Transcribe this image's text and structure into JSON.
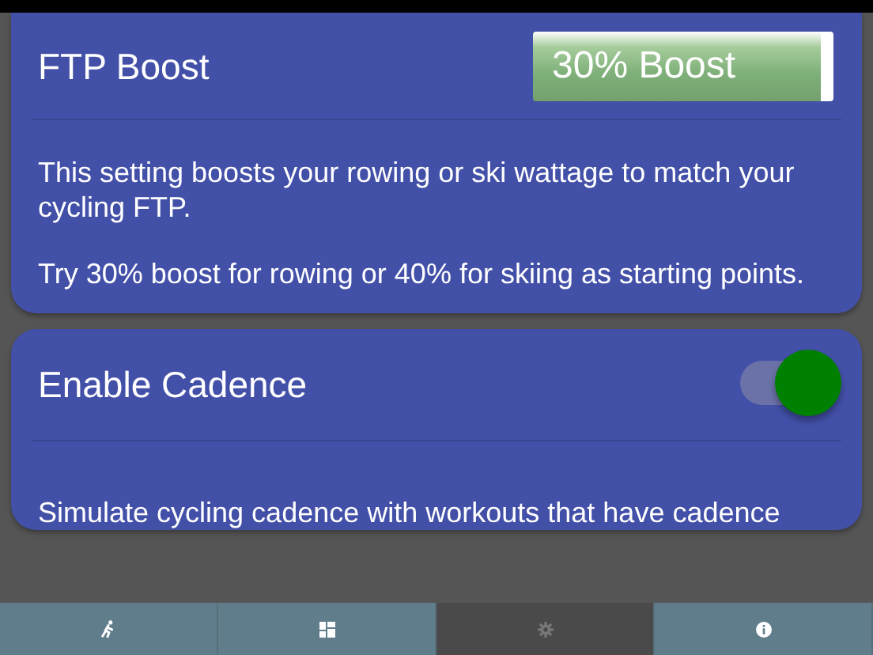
{
  "sections": [
    {
      "kind": "select",
      "title": "FTP Boost",
      "value": "30% Boost",
      "paragraphs": [
        "This setting boosts your rowing or ski wattage to match your cycling FTP.",
        "Try 30% boost for rowing or 40% for skiing as starting points."
      ]
    },
    {
      "kind": "toggle",
      "title": "Enable Cadence",
      "on": true,
      "paragraphs": [
        "Simulate cycling cadence with workouts that have cadence"
      ]
    }
  ],
  "tab_bar": [
    {
      "selected": false
    },
    {
      "selected": false
    },
    {
      "selected": true
    },
    {
      "selected": false
    }
  ]
}
